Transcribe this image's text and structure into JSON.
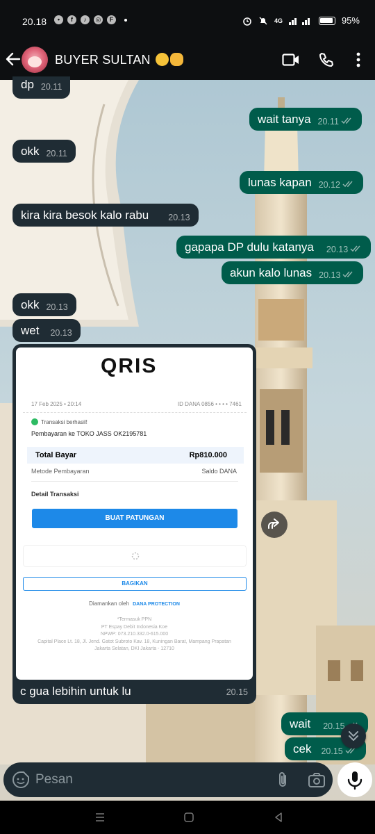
{
  "status_bar": {
    "time": "20.18",
    "network": "4G",
    "battery": "95%"
  },
  "header": {
    "contact_name": "BUYER SULTAN"
  },
  "messages": [
    {
      "text": "dp",
      "time": "20.11",
      "dir": "in"
    },
    {
      "text": "wait tanya",
      "time": "20.11",
      "dir": "out"
    },
    {
      "text": "okk",
      "time": "20.11",
      "dir": "in"
    },
    {
      "text": "lunas kapan",
      "time": "20.12",
      "dir": "out"
    },
    {
      "text": "kira kira besok kalo rabu",
      "time": "20.13",
      "dir": "in"
    },
    {
      "text": "gapapa DP dulu katanya",
      "time": "20.13",
      "dir": "out"
    },
    {
      "text": "akun kalo lunas",
      "time": "20.13",
      "dir": "out"
    },
    {
      "text": "okk",
      "time": "20.13",
      "dir": "in"
    },
    {
      "text": "wet",
      "time": "20.13",
      "dir": "in"
    },
    {
      "text": "wait",
      "time": "20.15",
      "dir": "out"
    },
    {
      "text": "cek",
      "time": "20.15",
      "dir": "out"
    }
  ],
  "image_message": {
    "caption": "c gua lebihin untuk lu",
    "time": "20.15",
    "receipt": {
      "logo": "QRIS",
      "date": "17 Feb 2025 • 20:14",
      "dana_id": "ID DANA 0856 • • • • 7461",
      "status": "Transaksi berhasil!",
      "merchant": "Pembayaran ke TOKO JASS OK2195781",
      "total_label": "Total Bayar",
      "total_value": "Rp810.000",
      "method_label": "Metode Pembayaran",
      "method_value": "Saldo DANA",
      "detail_label": "Detail Transaksi",
      "primary_button": "BUAT PATUNGAN",
      "share_button": "BAGIKAN",
      "secured_by": "Diamankan oleh",
      "protection": "DANA PROTECTION",
      "footer": [
        "*Termasuk PPN",
        "PT Espay Debit Indonesia Koe",
        "NPWP: 073.210.332.0-615.000",
        "Capital Place Lt. 18, Jl. Jend. Gatot Subroto Kav. 18, Kuningan Barat, Mampang Prapatan",
        "Jakarta Selatan, DKI Jakarta - 12710"
      ]
    }
  },
  "composer": {
    "placeholder": "Pesan"
  },
  "colors": {
    "incoming_bubble": "#1f2c34",
    "outgoing_bubble": "#005c4b",
    "header": "#0d0f11",
    "dana_blue": "#1d89e8"
  }
}
